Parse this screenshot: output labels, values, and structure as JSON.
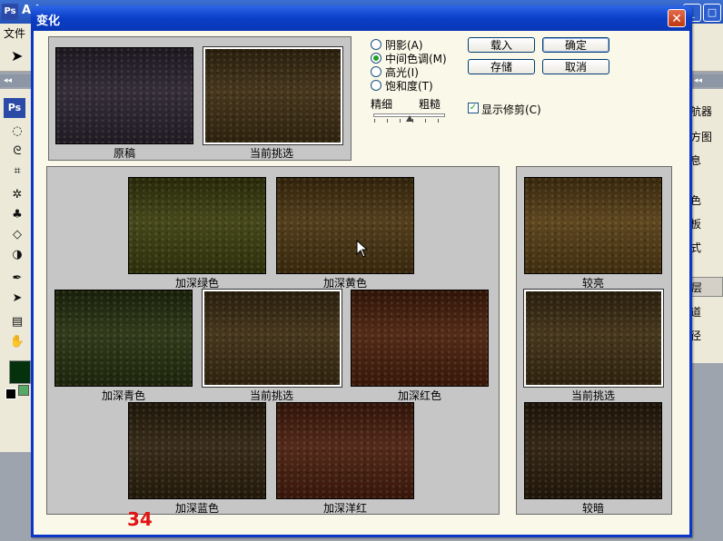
{
  "app": {
    "logo": "Ps",
    "title": "Ad",
    "menu_first": "文件",
    "toolbox_logo": "Ps",
    "right_panel_items": [
      "航器",
      "方图",
      "息",
      "色",
      "板",
      "式",
      "层",
      "道",
      "径"
    ],
    "fg_color": "#05320d"
  },
  "dialog": {
    "title": "变化",
    "close": "✕",
    "original_label": "原稿",
    "current_label": "当前挑选",
    "radios": [
      {
        "label": "阴影(A)",
        "checked": false
      },
      {
        "label": "中间色调(M)",
        "checked": true
      },
      {
        "label": "高光(I)",
        "checked": false
      },
      {
        "label": "饱和度(T)",
        "checked": false
      }
    ],
    "slider": {
      "fine": "精细",
      "coarse": "粗糙",
      "value": 0.5
    },
    "buttons": {
      "load": "载入",
      "ok": "确定",
      "save": "存储",
      "cancel": "取消"
    },
    "show_clipping": {
      "label": "显示修剪(C)",
      "checked": true
    },
    "variations": {
      "more_green": "加深绿色",
      "more_yellow": "加深黄色",
      "more_cyan": "加深青色",
      "current": "当前挑选",
      "more_red": "加深红色",
      "more_blue": "加深蓝色",
      "more_magenta": "加深洋红"
    },
    "brightness": {
      "lighter": "较亮",
      "current": "当前挑选",
      "darker": "较暗"
    },
    "overlay_number": "34"
  },
  "colors": {
    "original": "#2a2330",
    "current": "#3c2c12",
    "green": "#3b3e0e",
    "yellow": "#4a3411",
    "cyan": "#26300f",
    "red": "#4a1f0c",
    "blue": "#2e210f",
    "magenta": "#4a1e0e",
    "lighter": "#553c14",
    "darker": "#2a1c0c"
  }
}
